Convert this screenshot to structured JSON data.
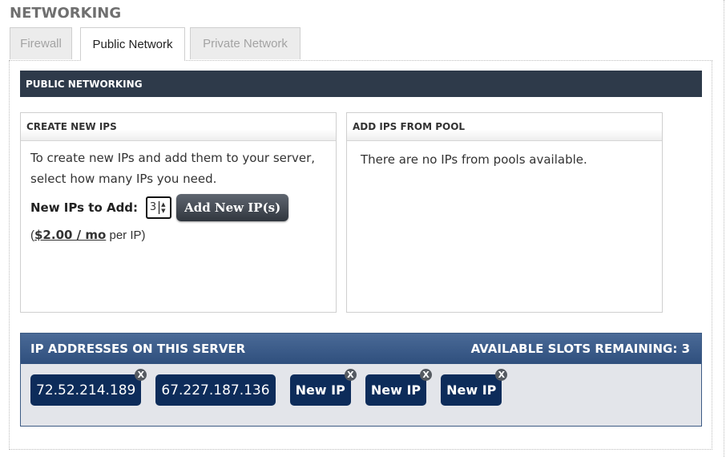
{
  "page": {
    "title": "NETWORKING"
  },
  "tabs": [
    {
      "label": "Firewall",
      "active": false
    },
    {
      "label": "Public Network",
      "active": true
    },
    {
      "label": "Private Network",
      "active": false
    }
  ],
  "section": {
    "title": "PUBLIC NETWORKING"
  },
  "create_box": {
    "title": "CREATE NEW IPS",
    "description": "To create new IPs and add them to your server, select how many IPs you need.",
    "count_label": "New IPs to Add:",
    "count_value": "3",
    "spinner_up_icon": "▲",
    "spinner_down_icon": "▼",
    "add_button": "Add New IP(s)",
    "price_open": "(",
    "price_link": "$2.00 / mo",
    "price_suffix": " per IP)"
  },
  "pool_box": {
    "title": "ADD IPS FROM POOL",
    "message": "There are no IPs from pools available."
  },
  "ip_section": {
    "title": "IP ADDRESSES ON THIS SERVER",
    "slots_label": "AVAILABLE SLOTS REMAINING: 3",
    "remove_icon": "X",
    "ips": [
      {
        "label": "72.52.214.189",
        "removable": true,
        "is_new": false
      },
      {
        "label": "67.227.187.136",
        "removable": false,
        "is_new": false
      },
      {
        "label": "New IP",
        "removable": true,
        "is_new": true
      },
      {
        "label": "New IP",
        "removable": true,
        "is_new": true
      },
      {
        "label": "New IP",
        "removable": true,
        "is_new": true
      }
    ]
  }
}
